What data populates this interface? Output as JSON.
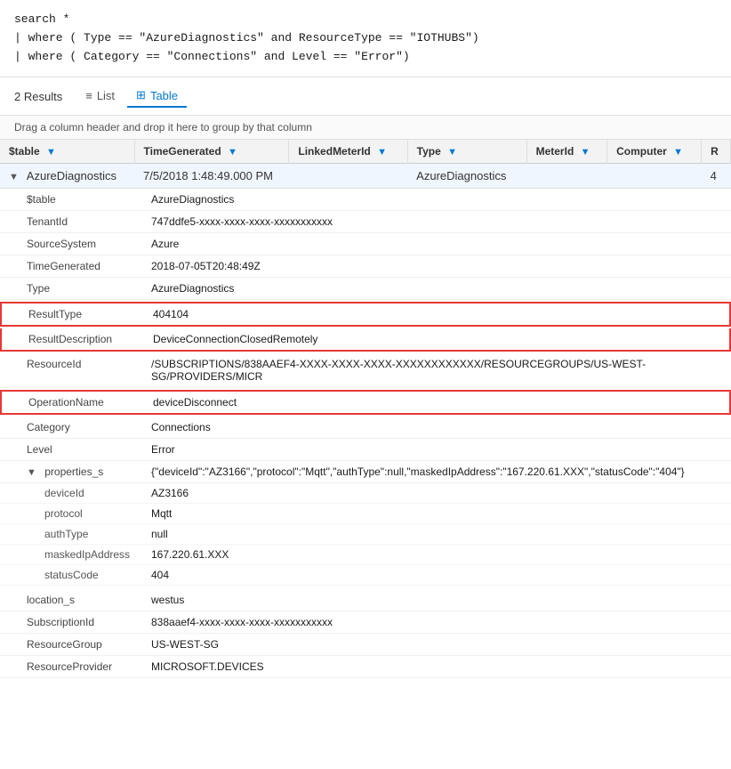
{
  "query": {
    "line1": "search *",
    "line2": "| where ( Type == \"AzureDiagnostics\" and ResourceType == \"IOTHUBS\")",
    "line3": "| where ( Category == \"Connections\" and Level == \"Error\")"
  },
  "results": {
    "count": "2",
    "label": "Results"
  },
  "tabs": [
    {
      "id": "list",
      "label": "List",
      "icon": "≡",
      "active": false
    },
    {
      "id": "table",
      "label": "Table",
      "icon": "⊞",
      "active": true
    }
  ],
  "drag_hint": "Drag a column header and drop it here to group by that column",
  "columns": [
    {
      "label": "$table",
      "id": "stable"
    },
    {
      "label": "TimeGenerated",
      "id": "timegenerated"
    },
    {
      "label": "LinkedMeterId",
      "id": "linkedmeterid"
    },
    {
      "label": "Type",
      "id": "type"
    },
    {
      "label": "MeterId",
      "id": "meterid"
    },
    {
      "label": "Computer",
      "id": "computer"
    },
    {
      "label": "R",
      "id": "r"
    }
  ],
  "main_row": {
    "expand": "▼",
    "stable": "AzureDiagnostics",
    "time": "7/5/2018 1:48:49.000 PM",
    "linked_meter_id": "",
    "type": "AzureDiagnostics",
    "meter_id": "",
    "computer": "",
    "r": "4"
  },
  "detail_fields": [
    {
      "label": "$table",
      "value": "AzureDiagnostics",
      "highlight": false,
      "sub": false
    },
    {
      "label": "TenantId",
      "value": "747ddfe5-xxxx-xxxx-xxxx-xxxxxxxxxxx",
      "highlight": false,
      "sub": false
    },
    {
      "label": "SourceSystem",
      "value": "Azure",
      "highlight": false,
      "sub": false
    },
    {
      "label": "TimeGenerated",
      "value": "2018-07-05T20:48:49Z",
      "highlight": false,
      "sub": false
    },
    {
      "label": "Type",
      "value": "AzureDiagnostics",
      "highlight": false,
      "sub": false
    },
    {
      "label": "ResultType",
      "value": "404104",
      "highlight": true,
      "sub": false
    },
    {
      "label": "ResultDescription",
      "value": "DeviceConnectionClosedRemotely",
      "highlight": true,
      "sub": false
    },
    {
      "label": "ResourceId",
      "value": "/SUBSCRIPTIONS/838AAEF4-XXXX-XXXX-XXXX-XXXXXXXXXXXX/RESOURCEGROUPS/US-WEST-SG/PROVIDERS/MICR",
      "highlight": false,
      "sub": false
    },
    {
      "label": "OperationName",
      "value": "deviceDisconnect",
      "highlight": true,
      "sub": false
    },
    {
      "label": "Category",
      "value": "Connections",
      "highlight": false,
      "sub": false
    },
    {
      "label": "Level",
      "value": "Error",
      "highlight": false,
      "sub": false
    }
  ],
  "properties_field": {
    "label": "properties_s",
    "value": "{\"deviceId\":\"AZ3166\",\"protocol\":\"Mqtt\",\"authType\":null,\"maskedIpAddress\":\"167.220.61.XXX\",\"statusCode\":\"404\"}",
    "sub_fields": [
      {
        "label": "deviceId",
        "value": "AZ3166"
      },
      {
        "label": "protocol",
        "value": "Mqtt"
      },
      {
        "label": "authType",
        "value": "null"
      },
      {
        "label": "maskedIpAddress",
        "value": "167.220.61.XXX"
      },
      {
        "label": "statusCode",
        "value": "404"
      }
    ]
  },
  "bottom_fields": [
    {
      "label": "location_s",
      "value": "westus"
    },
    {
      "label": "SubscriptionId",
      "value": "838aaef4-xxxx-xxxx-xxxx-xxxxxxxxxxx"
    },
    {
      "label": "ResourceGroup",
      "value": "US-WEST-SG"
    },
    {
      "label": "ResourceProvider",
      "value": "MICROSOFT.DEVICES"
    }
  ]
}
